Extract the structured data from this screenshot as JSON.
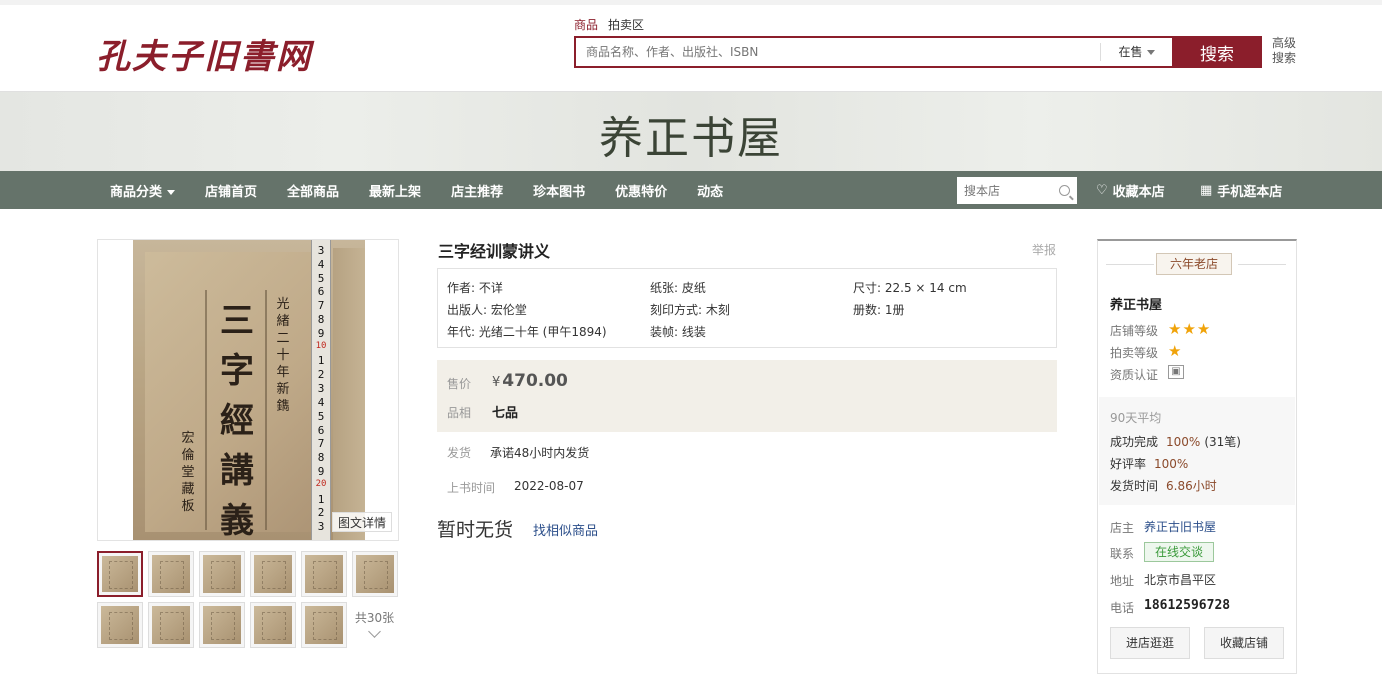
{
  "header": {
    "logo": "孔夫子旧書网",
    "search_tabs": [
      "商品",
      "拍卖区"
    ],
    "search_placeholder": "商品名称、作者、出版社、ISBN",
    "search_status": "在售",
    "search_button": "搜索",
    "advanced_search": "高级搜索"
  },
  "banner": {
    "shop_name": "养正书屋"
  },
  "nav": {
    "items": [
      "商品分类",
      "店铺首页",
      "全部商品",
      "最新上架",
      "店主推荐",
      "珍本图书",
      "优惠特价",
      "动态"
    ],
    "shop_search_placeholder": "搜本店",
    "favorite_shop": "收藏本店",
    "mobile_shop": "手机逛本店"
  },
  "gallery": {
    "cover_text": "三字經講義",
    "cover_side_text": "光緒二十年新鐫",
    "cover_side_text2": "宏倫堂藏板",
    "ruler_numbers": [
      "3",
      "4",
      "5",
      "6",
      "7",
      "8",
      "9",
      "10",
      "1",
      "2",
      "3",
      "4",
      "5",
      "6",
      "7",
      "8",
      "9",
      "20",
      "1",
      "2",
      "3"
    ],
    "detail_badge": "图文详情",
    "thumb_count": "共30张"
  },
  "product": {
    "title": "三字经训蒙讲义",
    "report": "举报",
    "attributes": [
      [
        "作者: 不详",
        "纸张: 皮纸",
        "尺寸: 22.5 × 14 cm"
      ],
      [
        "出版人: 宏伦堂",
        "刻印方式: 木刻",
        "册数: 1册"
      ],
      [
        "年代: 光绪二十年 (甲午1894)",
        "装帧: 线装",
        ""
      ]
    ],
    "price_label": "售价",
    "currency": "¥",
    "price": "470.00",
    "condition_label": "品相",
    "condition": "七品",
    "shipping_label": "发货",
    "shipping": "承诺48小时内发货",
    "listed_label": "上书时间",
    "listed_date": "2022-08-07",
    "sold_out": "暂时无货",
    "find_similar": "找相似商品"
  },
  "shop": {
    "age_badge": "六年老店",
    "name": "养正书屋",
    "shop_level_label": "店铺等级",
    "shop_level_stars": "★★★",
    "auction_level_label": "拍卖等级",
    "auction_level_stars": "★",
    "cert_label": "资质认证",
    "stats_head": "90天平均",
    "completion_label": "成功完成",
    "completion_value": "100%",
    "completion_count": "(31笔)",
    "rating_label": "好评率",
    "rating_value": "100%",
    "ship_time_label": "发货时间",
    "ship_time_value": "6.86小时",
    "owner_label": "店主",
    "owner": "养正古旧书屋",
    "contact_label": "联系",
    "contact_button": "在线交谈",
    "address_label": "地址",
    "address": "北京市昌平区",
    "phone_label": "电话",
    "phone": "18612596728",
    "enter_shop": "进店逛逛",
    "favorite_shop": "收藏店铺"
  },
  "colors": {
    "brand": "#8b1e2b",
    "nav_bg": "#65736a",
    "price_bg": "#f2efe8",
    "star": "#f0a30a",
    "link": "#2b4e8a"
  }
}
